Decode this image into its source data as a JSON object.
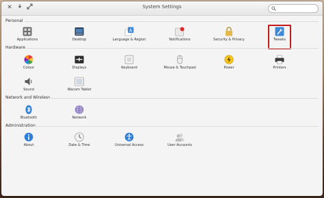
{
  "window": {
    "title": "System Settings",
    "search": {
      "value": "",
      "placeholder": ""
    }
  },
  "sections": [
    {
      "title": "Personal",
      "items": [
        {
          "label": "Applications",
          "icon": "applications-icon"
        },
        {
          "label": "Desktop",
          "icon": "desktop-icon"
        },
        {
          "label": "Language & Region",
          "icon": "language-icon"
        },
        {
          "label": "Notifications",
          "icon": "notifications-icon"
        },
        {
          "label": "Security & Privacy",
          "icon": "lock-icon"
        },
        {
          "label": "Tweaks",
          "icon": "tweaks-icon",
          "highlighted": true
        }
      ]
    },
    {
      "title": "Hardware",
      "items": [
        {
          "label": "Colour",
          "icon": "colour-wheel-icon"
        },
        {
          "label": "Displays",
          "icon": "displays-icon"
        },
        {
          "label": "Keyboard",
          "icon": "keyboard-icon"
        },
        {
          "label": "Mouse & Touchpad",
          "icon": "mouse-icon"
        },
        {
          "label": "Power",
          "icon": "power-icon"
        },
        {
          "label": "Printers",
          "icon": "printer-icon"
        },
        {
          "label": "Sound",
          "icon": "speaker-icon"
        },
        {
          "label": "Wacom Tablet",
          "icon": "tablet-icon"
        }
      ]
    },
    {
      "title": "Network and Wireless",
      "items": [
        {
          "label": "Bluetooth",
          "icon": "bluetooth-icon"
        },
        {
          "label": "Network",
          "icon": "network-globe-icon"
        }
      ]
    },
    {
      "title": "Administration",
      "items": [
        {
          "label": "About",
          "icon": "info-icon"
        },
        {
          "label": "Date & Time",
          "icon": "clock-icon"
        },
        {
          "label": "Universal Access",
          "icon": "accessibility-icon"
        },
        {
          "label": "User Accounts",
          "icon": "users-icon"
        }
      ]
    }
  ],
  "colors": {
    "highlight": "#c41a1a",
    "accent_blue": "#3f8ad8"
  }
}
